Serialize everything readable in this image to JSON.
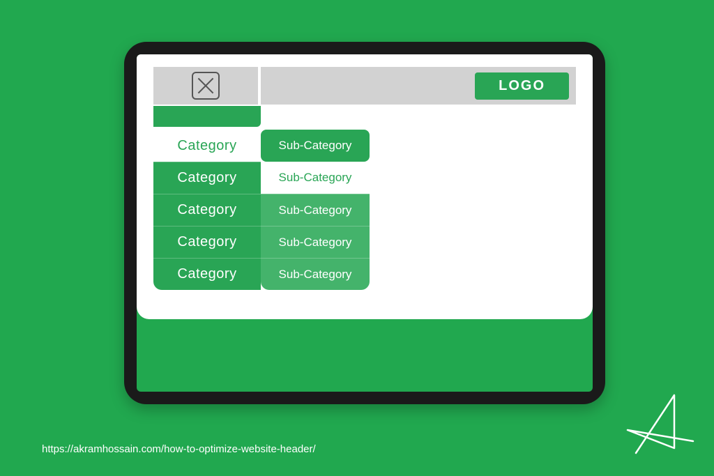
{
  "header": {
    "logo_text": "LOGO"
  },
  "menu": {
    "rows": [
      {
        "category": "Category",
        "sub": "Sub-Category"
      },
      {
        "category": "Category",
        "sub": "Sub-Category"
      },
      {
        "category": "Category",
        "sub": "Sub-Category"
      },
      {
        "category": "Category",
        "sub": "Sub-Category"
      },
      {
        "category": "Category",
        "sub": "Sub-Category"
      }
    ]
  },
  "footer": {
    "url": "https://akramhossain.com/how-to-optimize-website-header/"
  },
  "colors": {
    "brand_green": "#21a84f",
    "accent_green": "#29a555",
    "light_green": "#44b36b",
    "grey": "#d2d2d2"
  }
}
